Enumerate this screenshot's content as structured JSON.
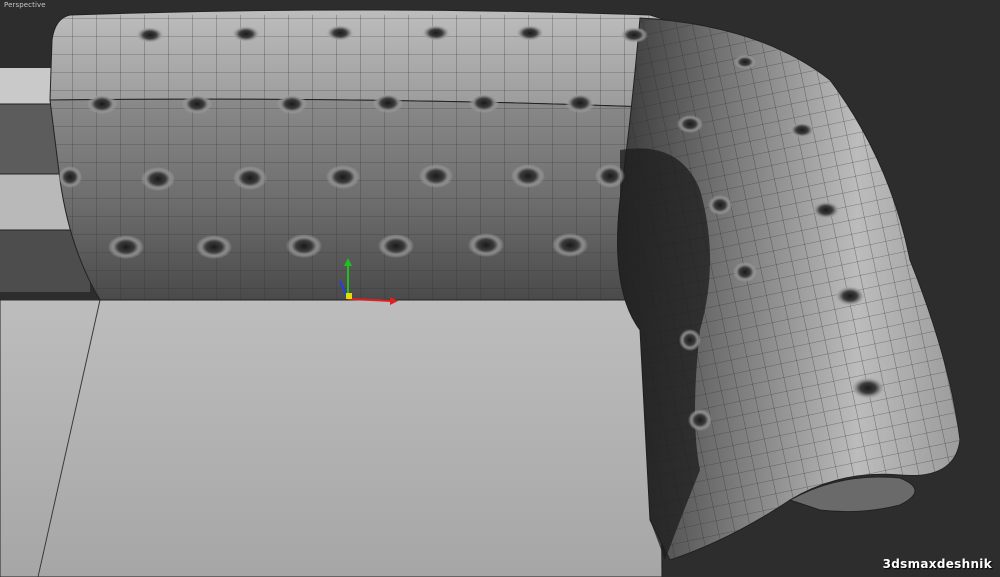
{
  "viewport": {
    "label": "Perspective",
    "shading": "smooth-with-wireframe",
    "background_color": "#2d2d2d"
  },
  "scene": {
    "object": "tufted-sofa-arm-mesh",
    "mesh_color": "#a9a9a9",
    "seat_color": "#b4b4b4",
    "wire_color": "#2a2a2a"
  },
  "gizmo": {
    "axes": [
      "x-axis",
      "y-axis",
      "z-axis"
    ],
    "colors": {
      "x": "#e02020",
      "y": "#20c020",
      "z": "#2040e0"
    }
  },
  "watermark": {
    "text": "3dsmaxdeshnik"
  }
}
